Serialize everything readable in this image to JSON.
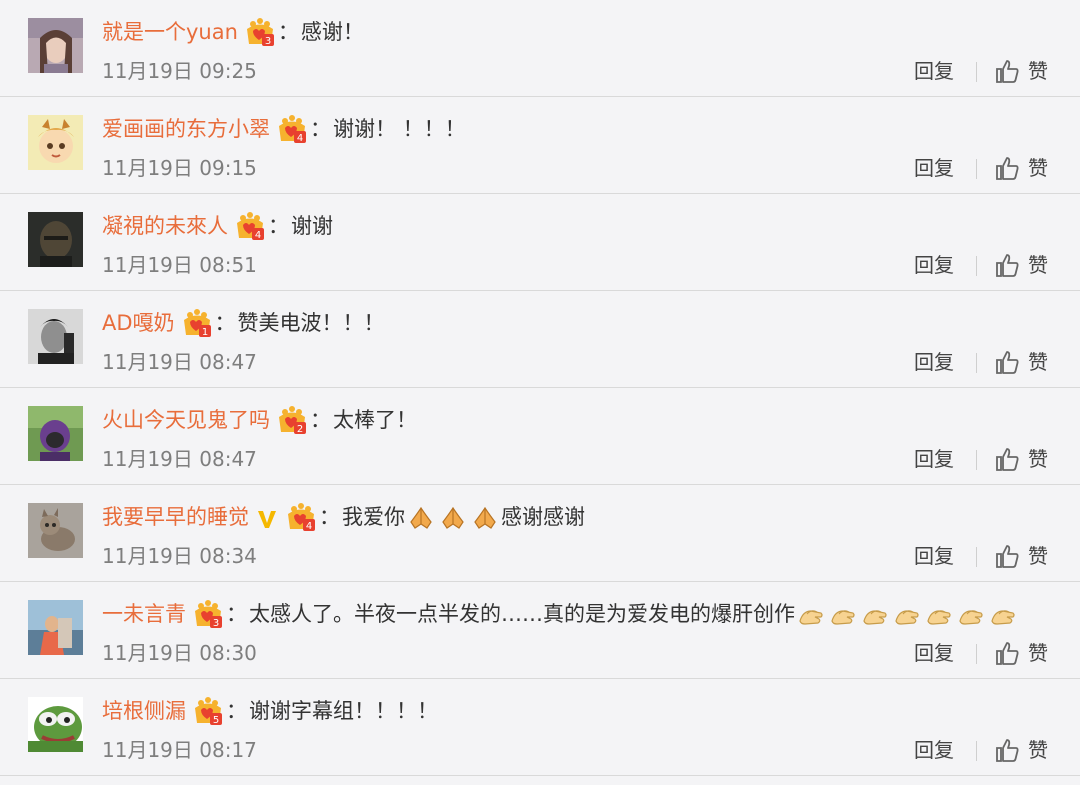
{
  "actions": {
    "reply_label": "回复",
    "like_label": "赞"
  },
  "comments": [
    {
      "user": "就是一个yuan",
      "text": "感谢！",
      "time": "11月19日 09:25",
      "vip_level": "3",
      "verified": false,
      "emoji": ""
    },
    {
      "user": "爱画画的东方小翠",
      "text": "谢谢！ ！！！",
      "time": "11月19日 09:15",
      "vip_level": "4",
      "verified": false,
      "emoji": ""
    },
    {
      "user": "凝視的未來人",
      "text": "谢谢",
      "time": "11月19日 08:51",
      "vip_level": "4",
      "verified": false,
      "emoji": ""
    },
    {
      "user": "AD嘎奶",
      "text": "赞美电波！！！",
      "time": "11月19日 08:47",
      "vip_level": "1",
      "verified": false,
      "emoji": ""
    },
    {
      "user": "火山今天见鬼了吗",
      "text": "太棒了！",
      "time": "11月19日 08:47",
      "vip_level": "2",
      "verified": false,
      "emoji": ""
    },
    {
      "user": "我要早早的睡觉",
      "text": "我爱你",
      "text_after": "感谢感谢",
      "time": "11月19日 08:34",
      "vip_level": "4",
      "verified": true,
      "emoji": "pray-emoji",
      "emoji_count": 3
    },
    {
      "user": "一未言青",
      "text": "太感人了。半夜一点半发的……真的是为爱发电的爆肝创作",
      "text_after": "",
      "time": "11月19日 08:30",
      "vip_level": "3",
      "verified": false,
      "emoji": "clap-hands-emoji",
      "emoji_count": 7
    },
    {
      "user": "培根侧漏",
      "text": "谢谢字幕组！！！！",
      "time": "11月19日 08:17",
      "vip_level": "5",
      "verified": false,
      "emoji": ""
    }
  ],
  "colors": {
    "username": "#e86d3b",
    "text": "#333333",
    "time": "#7e7e7e",
    "background": "#f4f4f6",
    "vip_gold": "#f6b22e",
    "vip_red": "#e8412f"
  }
}
